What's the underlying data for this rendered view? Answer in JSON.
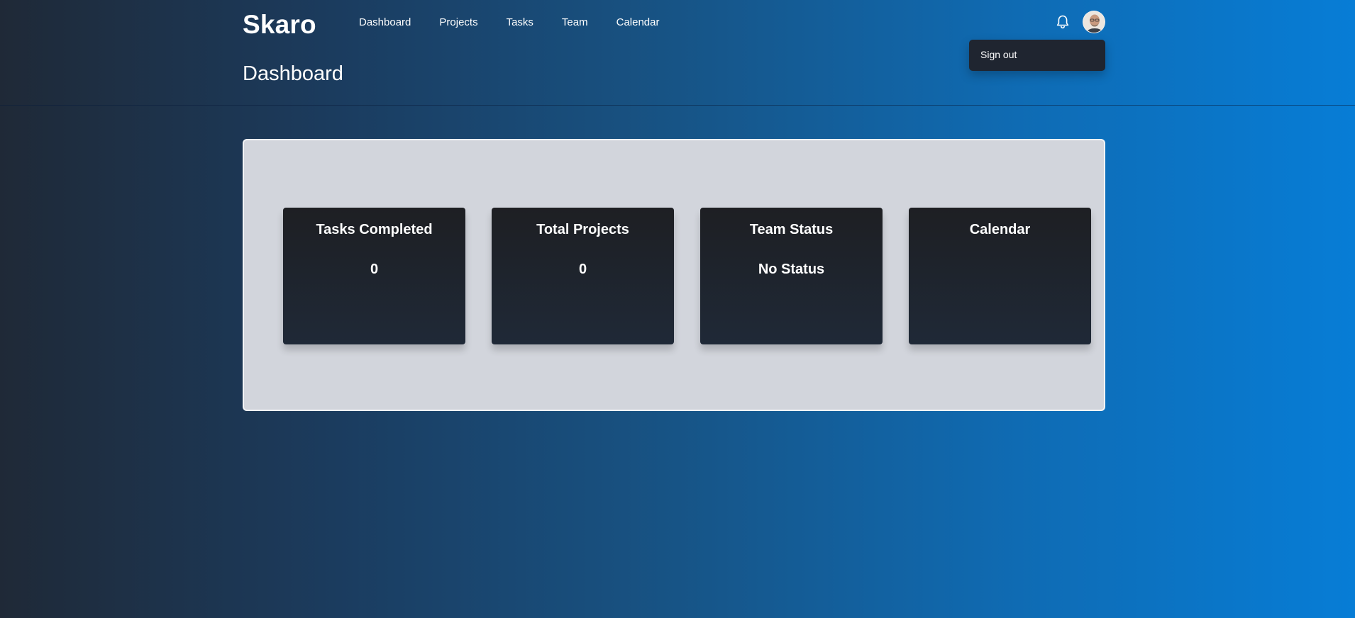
{
  "brand": "Skaro",
  "nav": [
    "Dashboard",
    "Projects",
    "Tasks",
    "Team",
    "Calendar"
  ],
  "icons": {
    "notifications": "bell-icon",
    "user": "avatar"
  },
  "dropdown": {
    "sign_out": "Sign out"
  },
  "page_title": "Dashboard",
  "cards": [
    {
      "title": "Tasks Completed",
      "value": "0"
    },
    {
      "title": "Total Projects",
      "value": "0"
    },
    {
      "title": "Team Status",
      "value": "No Status"
    },
    {
      "title": "Calendar",
      "value": ""
    }
  ],
  "colors": {
    "background_start": "#1f2937",
    "background_end": "#077dd6",
    "panel": "#d2d5dc",
    "card": "#1f2229",
    "dropdown": "#1f2530"
  }
}
